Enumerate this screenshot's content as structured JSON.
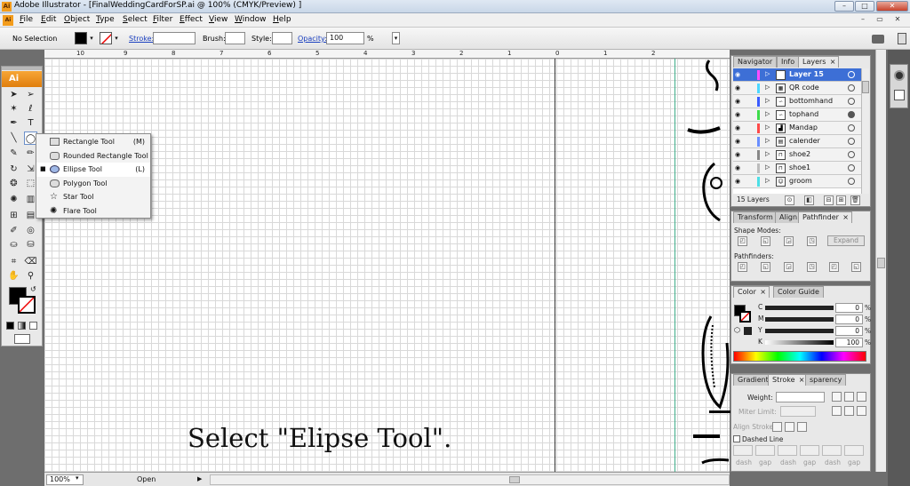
{
  "window": {
    "app_icon": "Ai",
    "title": "Adobe Illustrator - [FinalWeddingCardForSP.ai @ 100% (CMYK/Preview) ]",
    "min": "–",
    "max": "□",
    "close": "✕"
  },
  "menu": {
    "icon": "Ai",
    "items": [
      "File",
      "Edit",
      "Object",
      "Type",
      "Select",
      "Filter",
      "Effect",
      "View",
      "Window",
      "Help"
    ],
    "mdi_min": "–",
    "mdi_max": "▭",
    "mdi_close": "✕"
  },
  "control": {
    "selection": "No Selection",
    "stroke_label": "Stroke:",
    "brush_label": "Brush:",
    "style_label": "Style:",
    "opacity_label": "Opacity:",
    "opacity_value": "100",
    "percent": "%"
  },
  "toolbox": {
    "logo": "Ai"
  },
  "ruler": {
    "h_labels": [
      "10",
      "9",
      "8",
      "7",
      "6",
      "5",
      "4",
      "3",
      "2",
      "1",
      "0",
      "1",
      "2"
    ],
    "v_labels": [
      "3",
      "4",
      "5",
      "6",
      "7",
      "8",
      "9"
    ]
  },
  "flyout": {
    "items": [
      {
        "label": "Rectangle Tool",
        "shortcut": "(M)",
        "icon": "rectangle-icon"
      },
      {
        "label": "Rounded Rectangle Tool",
        "shortcut": "",
        "icon": "rounded-rectangle-icon"
      },
      {
        "label": "Ellipse Tool",
        "shortcut": "(L)",
        "icon": "ellipse-icon",
        "selected": true
      },
      {
        "label": "Polygon Tool",
        "shortcut": "",
        "icon": "polygon-icon"
      },
      {
        "label": "Star Tool",
        "shortcut": "",
        "icon": "star-icon"
      },
      {
        "label": "Flare Tool",
        "shortcut": "",
        "icon": "flare-icon"
      }
    ]
  },
  "caption": "Select \"Elipse Tool\".",
  "status": {
    "zoom": "100%",
    "state": "Open"
  },
  "layers_panel": {
    "tabs": [
      "Navigator",
      "Info",
      "Layers"
    ],
    "active_tab": "Layers",
    "count_label": "15 Layers",
    "rows": [
      {
        "name": "Layer 15",
        "color": "#ff4dff",
        "thumb": "",
        "selected": true
      },
      {
        "name": "QR code",
        "color": "#4dd8ff",
        "thumb": "▦"
      },
      {
        "name": "bottomhand",
        "color": "#3a5bff",
        "thumb": "∽"
      },
      {
        "name": "tophand",
        "color": "#3ddc4a",
        "thumb": "∽",
        "target_filled": true
      },
      {
        "name": "Mandap",
        "color": "#ff4a4a",
        "thumb": "▟"
      },
      {
        "name": "calender",
        "color": "#6a8fff",
        "thumb": "▤"
      },
      {
        "name": "shoe2",
        "color": "#888888",
        "thumb": "⊓"
      },
      {
        "name": "shoe1",
        "color": "#bbbbbb",
        "thumb": "⊓"
      },
      {
        "name": "groom",
        "color": "#4ddfe6",
        "thumb": "☺"
      }
    ]
  },
  "pathfinder_panel": {
    "tabs": [
      "Transform",
      "Align",
      "Pathfinder"
    ],
    "active_tab": "Pathfinder",
    "shape_modes_label": "Shape Modes:",
    "expand_label": "Expand",
    "pathfinders_label": "Pathfinders:"
  },
  "color_panel": {
    "tabs": [
      "Color",
      "Color Guide"
    ],
    "active_tab": "Color",
    "channels": [
      {
        "label": "C",
        "value": "0",
        "unit": "%",
        "color": "#00aee8"
      },
      {
        "label": "M",
        "value": "0",
        "unit": "%",
        "color": "#e0188a"
      },
      {
        "label": "Y",
        "value": "0",
        "unit": "%",
        "color": "#f5e400"
      },
      {
        "label": "K",
        "value": "100",
        "unit": "%",
        "color": "#000000"
      }
    ]
  },
  "stroke_panel": {
    "tabs": [
      "Gradient",
      "Stroke",
      "Transparency"
    ],
    "tab_display": [
      "Gradient",
      "Stroke",
      "sparency"
    ],
    "active_tab": "Stroke",
    "weight_label": "Weight:",
    "miter_label": "Miter Limit:",
    "align_label": "Align Stroke:",
    "dashed_label": "Dashed Line",
    "dash_labels": [
      "dash",
      "gap",
      "dash",
      "gap",
      "dash",
      "gap"
    ]
  }
}
